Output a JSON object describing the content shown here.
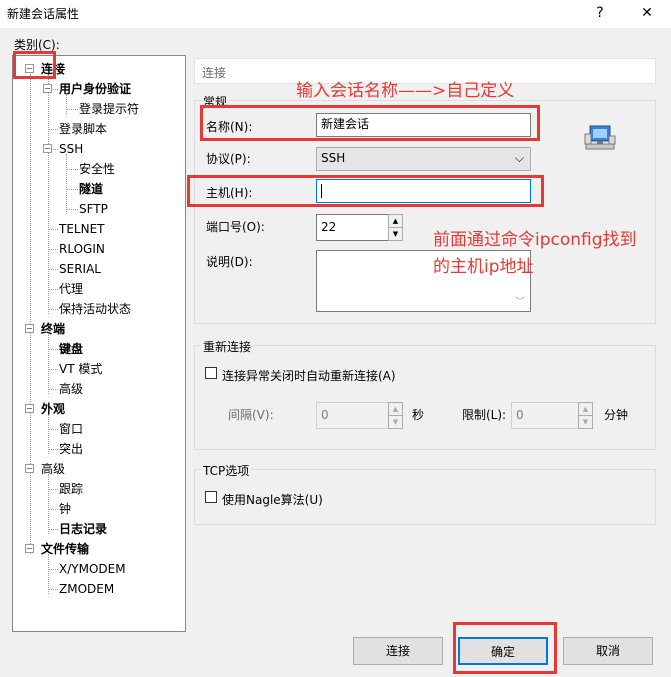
{
  "window": {
    "title": "新建会话属性",
    "help_glyph": "?",
    "close_glyph": "✕"
  },
  "category_label": "类别(C):",
  "tree": [
    {
      "label": "连接",
      "bold": true
    },
    {
      "label": "用户身份验证",
      "bold": true
    },
    {
      "label": "登录提示符"
    },
    {
      "label": "登录脚本"
    },
    {
      "label": "SSH"
    },
    {
      "label": "安全性"
    },
    {
      "label": "隧道",
      "bold": true
    },
    {
      "label": "SFTP"
    },
    {
      "label": "TELNET"
    },
    {
      "label": "RLOGIN"
    },
    {
      "label": "SERIAL"
    },
    {
      "label": "代理"
    },
    {
      "label": "保持活动状态"
    },
    {
      "label": "终端",
      "bold": true
    },
    {
      "label": "键盘",
      "bold": true
    },
    {
      "label": "VT 模式"
    },
    {
      "label": "高级"
    },
    {
      "label": "外观",
      "bold": true
    },
    {
      "label": "窗口"
    },
    {
      "label": "突出"
    },
    {
      "label": "高级"
    },
    {
      "label": "跟踪"
    },
    {
      "label": "钟"
    },
    {
      "label": "日志记录",
      "bold": true
    },
    {
      "label": "文件传输",
      "bold": true
    },
    {
      "label": "X/YMODEM"
    },
    {
      "label": "ZMODEM"
    }
  ],
  "tree_expander_glyph": "−",
  "section_header": "连接",
  "general": {
    "title": "常规",
    "name_label": "名称(N):",
    "name_value": "新建会话",
    "protocol_label": "协议(P):",
    "protocol_value": "SSH",
    "host_label": "主机(H):",
    "host_value": "",
    "port_label": "端口号(O):",
    "port_value": "22",
    "desc_label": "说明(D):",
    "desc_value": ""
  },
  "reconnect": {
    "title": "重新连接",
    "checkbox_label": "连接异常关闭时自动重新连接(A)",
    "interval_label": "间隔(V):",
    "interval_value": "0",
    "seconds_label": "秒",
    "limit_label": "限制(L):",
    "limit_value": "0",
    "minutes_label": "分钟"
  },
  "tcp": {
    "title": "TCP选项",
    "nagle_label": "使用Nagle算法(U)"
  },
  "buttons": {
    "connect": "连接",
    "ok": "确定",
    "cancel": "取消"
  },
  "annotations": {
    "name_hint": "输入会话名称——>自己定义",
    "host_hint_line1": "前面通过命令ipconfig找到",
    "host_hint_line2": "的主机ip地址"
  },
  "glyphs": {
    "spin_up": "▲",
    "spin_down": "▼",
    "dropdown": "⌵",
    "scroll_up": "︿",
    "scroll_down": "﹀"
  },
  "colors": {
    "annotation": "#e53935"
  }
}
